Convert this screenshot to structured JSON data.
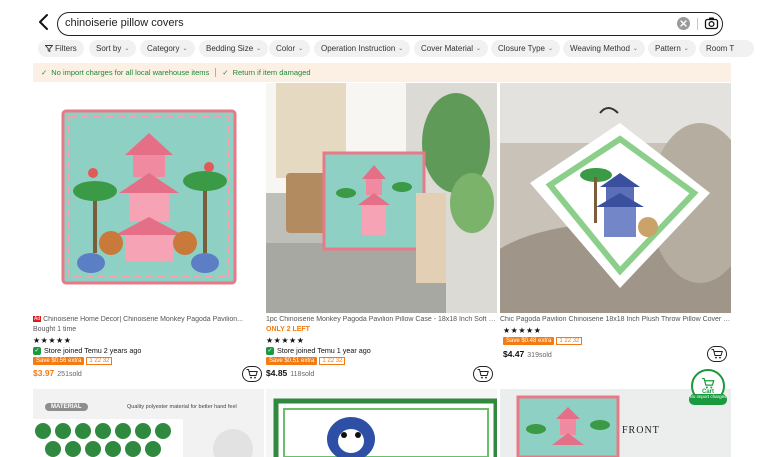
{
  "search": {
    "query": "chinoiserie pillow covers"
  },
  "filters": [
    {
      "label": "Filters",
      "has_chevron": false
    },
    {
      "label": "Sort by",
      "has_chevron": true
    },
    {
      "label": "Category",
      "has_chevron": true
    },
    {
      "label": "Bedding Size",
      "has_chevron": true
    },
    {
      "label": "Color",
      "has_chevron": true
    },
    {
      "label": "Operation Instruction",
      "has_chevron": true
    },
    {
      "label": "Cover Material",
      "has_chevron": true
    },
    {
      "label": "Closure Type",
      "has_chevron": true
    },
    {
      "label": "Weaving Method",
      "has_chevron": true
    },
    {
      "label": "Pattern",
      "has_chevron": true
    },
    {
      "label": "Room T",
      "has_chevron": false
    }
  ],
  "banner": {
    "item1": "No import charges for all local warehouse items",
    "item2": "Return if item damaged"
  },
  "products": [
    {
      "title": "Chinoiserie Home Decor| Chinoiserie Monkey Pagoda Pavilion...",
      "ad_tag": "Ad",
      "status": "Bought 1 time",
      "status_color": "#555555",
      "stars": "★★★★★",
      "store": "Store joined Temu 2 years ago",
      "save": "Save $0.56 extra",
      "timer": "1 22 32",
      "price": "$3.97",
      "sold": "251sold",
      "price_orange": true
    },
    {
      "title": "1pc Chinoiserie Monkey Pagoda Pavilion Pillow Case - 18x18 Inch Soft S...",
      "status": "ONLY 2 LEFT",
      "status_color": "#f47a12",
      "stars": "★★★★★",
      "store": "Store joined Temu 1 year ago",
      "save": "Save $0.51 extra",
      "timer": "1 22 32",
      "price": "$4.85",
      "sold": "118sold",
      "price_orange": false
    },
    {
      "title": "Chic Pagoda Pavilion Chinoiserie 18x18 Inch Plush Throw Pillow Cover -...",
      "stars": "★★★★★",
      "save": "Save $0.48 extra",
      "timer": "1 22 32",
      "price": "$4.47",
      "sold": "319sold",
      "price_orange": false
    }
  ],
  "bottom_cards": [
    {
      "badge": "MATERIAL",
      "caption": "Quality polyester material for better hand feel"
    },
    {},
    {
      "caption": "FRONT"
    }
  ],
  "float_cart": {
    "label": "Cart",
    "badge": "No import charges"
  },
  "colors": {
    "accent_green": "#1a9a3f",
    "accent_orange": "#f47a12",
    "banner_bg": "#fcf0e4"
  },
  "icons": [
    "back-icon",
    "clear-icon",
    "camera-icon",
    "filter-icon",
    "chevron-down-icon",
    "check-icon",
    "cart-icon"
  ]
}
